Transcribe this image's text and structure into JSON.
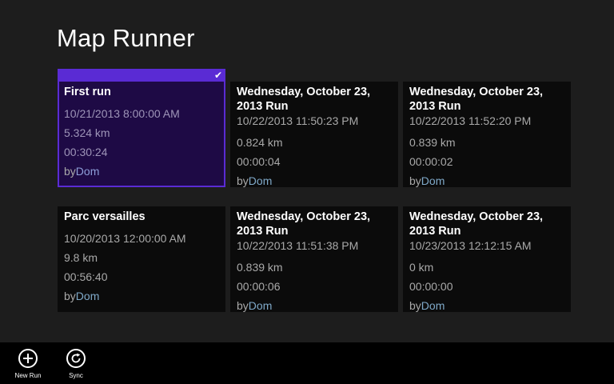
{
  "app": {
    "title": "Map Runner"
  },
  "runs": [
    {
      "title": "First run",
      "date": "10/21/2013 8:00:00 AM",
      "distance": "5.324 km",
      "duration": "00:30:24",
      "by_prefix": "by",
      "by_name": "Dom",
      "selected": true
    },
    {
      "title": "Wednesday, October 23, 2013  Run",
      "date": "10/22/2013 11:50:23 PM",
      "distance": "0.824 km",
      "duration": "00:00:04",
      "by_prefix": "by",
      "by_name": "Dom"
    },
    {
      "title": "Wednesday, October 23, 2013  Run",
      "date": "10/22/2013 11:52:20 PM",
      "distance": "0.839 km",
      "duration": "00:00:02",
      "by_prefix": "by",
      "by_name": "Dom"
    },
    {
      "title": "Parc versailles",
      "date": "10/20/2013 12:00:00 AM",
      "distance": "9.8 km",
      "duration": "00:56:40",
      "by_prefix": "by",
      "by_name": "Dom"
    },
    {
      "title": "Wednesday, October 23, 2013  Run",
      "date": "10/22/2013 11:51:38 PM",
      "distance": "0.839 km",
      "duration": "00:00:06",
      "by_prefix": "by",
      "by_name": "Dom"
    },
    {
      "title": "Wednesday, October 23, 2013  Run",
      "date": "10/23/2013 12:12:15 AM",
      "distance": "0 km",
      "duration": "00:00:00",
      "by_prefix": "by",
      "by_name": "Dom"
    }
  ],
  "app_bar": {
    "new_run_label": "New Run",
    "sync_label": "Sync",
    "new_run_icon": "add-icon",
    "sync_icon": "refresh-icon"
  },
  "colors": {
    "background": "#1d1d1d",
    "tile": "#0b0b0b",
    "selected_tile": "#1e0a45",
    "accent": "#5a2bd4",
    "by_name": "#7fa9c9"
  }
}
